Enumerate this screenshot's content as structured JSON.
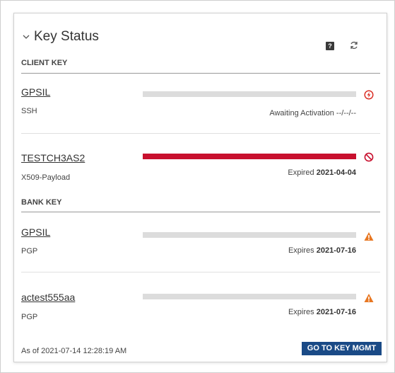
{
  "widget": {
    "title": "Key Status",
    "help_glyph": "?",
    "client_section_label": "CLIENT KEY",
    "bank_section_label": "BANK KEY",
    "client_keys": [
      {
        "name": "GPSIL",
        "type": "SSH",
        "progress": 0.0,
        "status_prefix": "Awaiting Activation",
        "status_value": "--/--/--",
        "status_icon": "lightning-circle-icon",
        "status_color": "#d9261c"
      },
      {
        "name": "TESTCH3AS2",
        "type": "X509-Payload",
        "progress": 1.0,
        "status_prefix": "Expired",
        "status_value": "2021-04-04",
        "status_icon": "prohibited-icon",
        "status_color": "#c8102e"
      }
    ],
    "bank_keys": [
      {
        "name": "GPSIL",
        "type": "PGP",
        "progress": 0.0,
        "status_prefix": "Expires",
        "status_value": "2021-07-16",
        "status_icon": "warning-triangle-icon",
        "status_color": "#e87722"
      },
      {
        "name": "actest555aa",
        "type": "PGP",
        "progress": 0.0,
        "status_prefix": "Expires",
        "status_value": "2021-07-16",
        "status_icon": "warning-triangle-icon",
        "status_color": "#e87722"
      }
    ],
    "as_of_text": "As of 2021-07-14 12:28:19 AM",
    "go_button_label": "GO TO KEY MGMT"
  },
  "colors": {
    "accent": "#1a4a86",
    "bar_track": "#dcdcdc",
    "expired_bar": "#c8102e"
  }
}
